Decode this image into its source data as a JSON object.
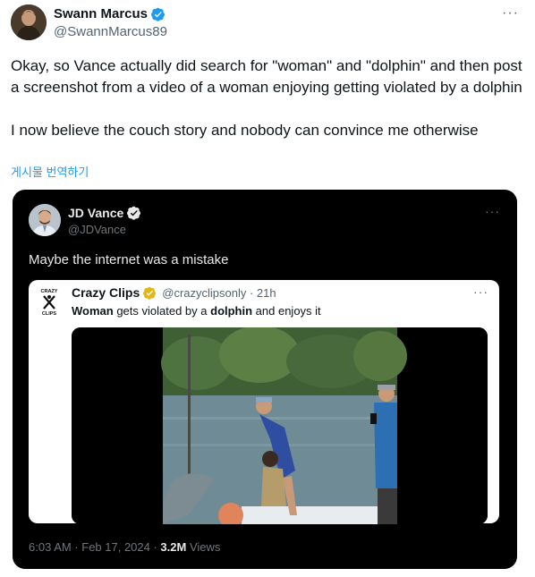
{
  "outer": {
    "author_name": "Swann Marcus",
    "author_handle": "@SwannMarcus89",
    "text": "Okay, so Vance actually did search for \"woman\" and \"dolphin\" and then post a screenshot from a video of a woman enjoying getting violated by a dolphin\n\nI now believe the couch story and nobody can convince me otherwise",
    "translate": "게시물 번역하기",
    "more": "···"
  },
  "quoted": {
    "author_name": "JD Vance",
    "author_handle": "@JDVance",
    "text": "Maybe the internet was a mistake",
    "more": "···",
    "timestamp": "6:03 AM · Feb 17, 2024 · ",
    "views_count": "3.2M",
    "views_label": " Views"
  },
  "inner": {
    "author_name": "Crazy Clips",
    "handle_time": "@crazyclipsonly · 21h",
    "text_part1": "Woman",
    "text_part2": " gets violated by a ",
    "text_part3": "dolphin",
    "text_part4": " and enjoys it",
    "more": "···",
    "logo_top": "CRAZY",
    "logo_bottom": "CLIPS"
  },
  "colors": {
    "verified_blue": "#1d9bf0",
    "verified_gold": "#e2b719",
    "link": "#1d9bf0"
  }
}
